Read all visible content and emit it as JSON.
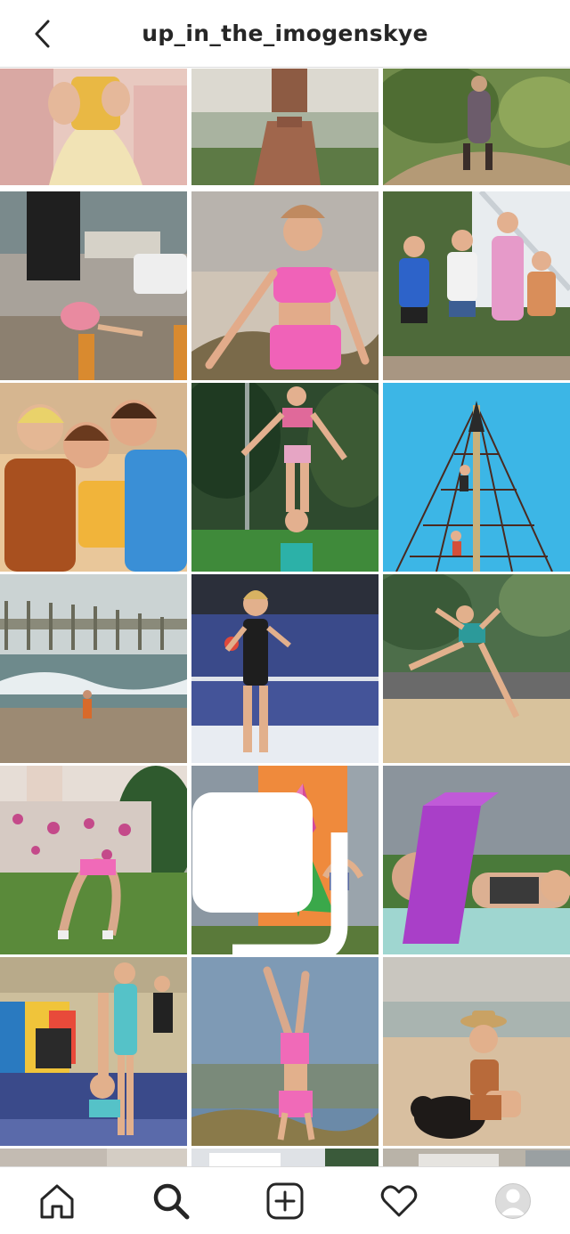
{
  "header": {
    "username": "up_in_the_imogenskye",
    "back_icon": "chevron-left-icon"
  },
  "grid": {
    "columns": 3,
    "posts": [
      {
        "id": "post-1",
        "desc": "girl in yellow tutu dress",
        "multi": false
      },
      {
        "id": "post-2",
        "desc": "girl in brown two-piece outfit",
        "multi": false
      },
      {
        "id": "post-3",
        "desc": "girl walking on bush path",
        "multi": false
      },
      {
        "id": "post-4",
        "desc": "girl stretching on street",
        "multi": false
      },
      {
        "id": "post-5",
        "desc": "girl in pink crop top on beach dunes",
        "multi": false
      },
      {
        "id": "post-6",
        "desc": "four kids posing by stairs",
        "multi": false
      },
      {
        "id": "post-7",
        "desc": "three girls posing at beach",
        "multi": false
      },
      {
        "id": "post-8",
        "desc": "acrobatic stack on grass",
        "multi": false
      },
      {
        "id": "post-9",
        "desc": "rope climbing pyramid",
        "multi": false
      },
      {
        "id": "post-10",
        "desc": "child at shoreline by pier",
        "multi": false
      },
      {
        "id": "post-11",
        "desc": "gymnast posing in black leotard",
        "multi": false
      },
      {
        "id": "post-12",
        "desc": "leaping dancer in park",
        "multi": false
      },
      {
        "id": "post-13",
        "desc": "bridge pose on lawn",
        "multi": false
      },
      {
        "id": "post-14",
        "desc": "two girls in front of flower mural",
        "multi": true
      },
      {
        "id": "post-15",
        "desc": "girl lying beside purple balance beam",
        "multi": false
      },
      {
        "id": "post-16",
        "desc": "gymnastics hall acrobatics",
        "multi": false
      },
      {
        "id": "post-17",
        "desc": "handstand on beach",
        "multi": false
      },
      {
        "id": "post-18",
        "desc": "girl in hat with dog on beach",
        "multi": false
      }
    ]
  },
  "tabbar": {
    "items": [
      {
        "name": "home",
        "icon": "home-icon"
      },
      {
        "name": "search",
        "icon": "search-icon",
        "active": true
      },
      {
        "name": "new-post",
        "icon": "add-post-icon"
      },
      {
        "name": "activity",
        "icon": "heart-icon"
      },
      {
        "name": "profile",
        "icon": "avatar"
      }
    ]
  },
  "colors": {
    "text": "#262626",
    "border": "#dbdbdb",
    "background": "#ffffff"
  }
}
